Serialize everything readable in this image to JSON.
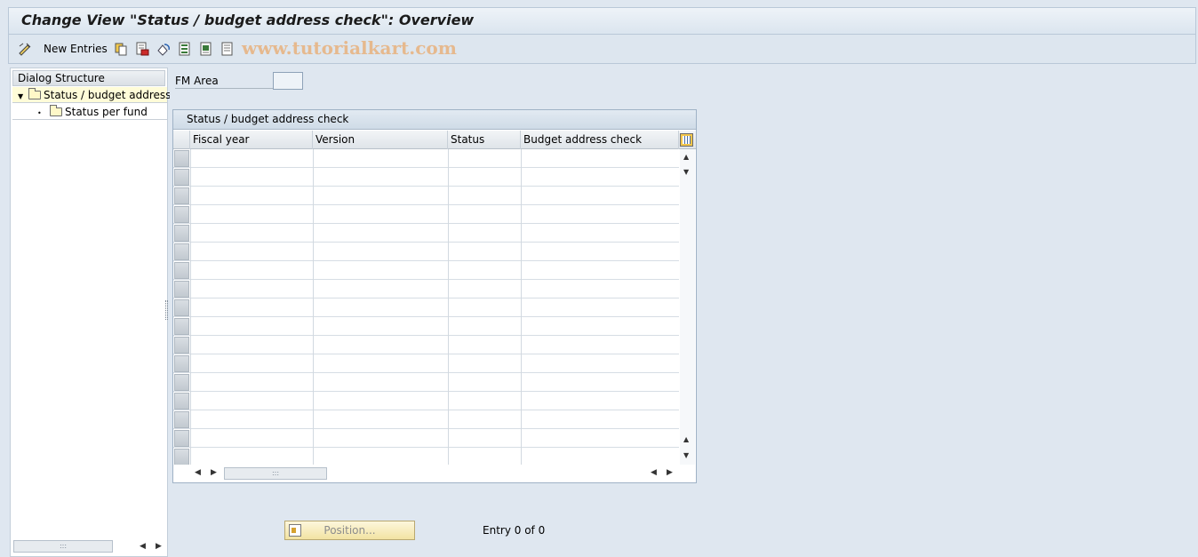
{
  "window": {
    "title": "Change View \"Status / budget address check\": Overview"
  },
  "toolbar": {
    "new_entries_label": "New Entries",
    "watermark": "www.tutorialkart.com",
    "icons": [
      "edit-pencil-icon",
      "copy-icon",
      "delete-icon",
      "undo-change-icon",
      "select-all-icon",
      "select-block-icon",
      "deselect-all-icon"
    ]
  },
  "sidebar": {
    "header": "Dialog Structure",
    "items": [
      {
        "label": "Status / budget address",
        "expanded": true,
        "selected": true
      },
      {
        "label": "Status per fund",
        "expanded": false,
        "selected": false
      }
    ]
  },
  "filter": {
    "fm_area_label": "FM Area",
    "fm_area_value": ""
  },
  "table": {
    "title": "Status / budget address check",
    "columns": [
      "Fiscal year",
      "Version",
      "Status",
      "Budget address check"
    ],
    "row_count_visible": 17,
    "rows": []
  },
  "footer": {
    "position_button_label": "Position...",
    "entry_text": "Entry 0 of 0"
  },
  "colors": {
    "background": "#dfe7f0",
    "selected_tree_row": "#fffcd8",
    "button_yellow": "#f2e3a2"
  }
}
